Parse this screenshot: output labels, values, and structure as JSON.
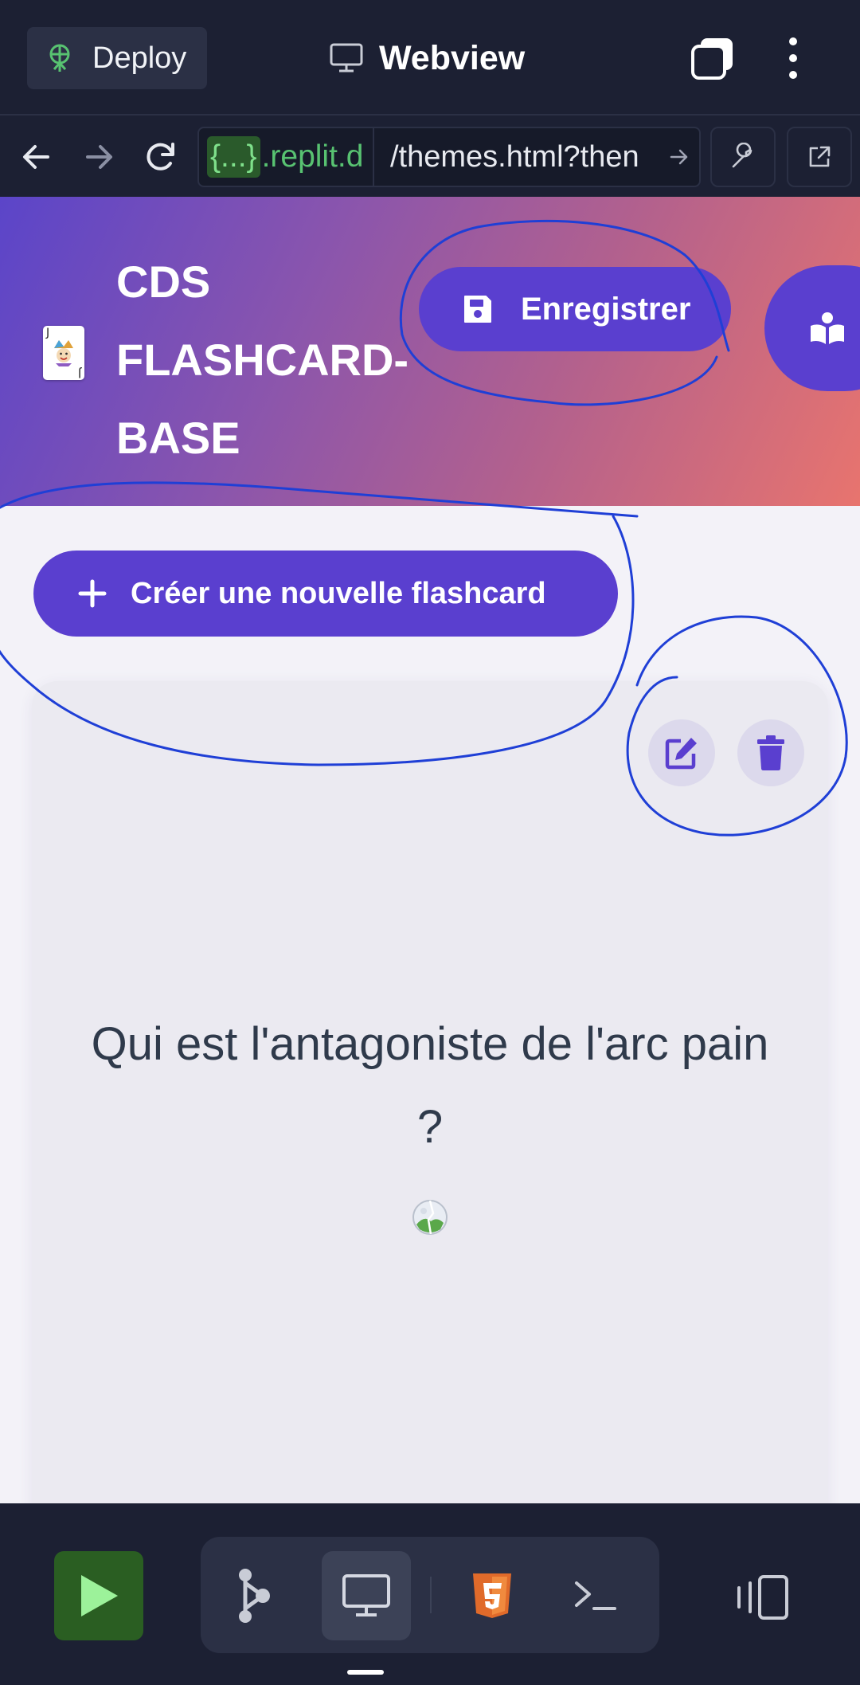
{
  "replit": {
    "deploy_label": "Deploy",
    "webview_title": "Webview",
    "url_host_braces": "{...}",
    "url_host_rest": ".replit.d",
    "url_path": "/themes.html?then"
  },
  "app": {
    "title_lines": [
      "CDS",
      "FLASHCARD-",
      "BASE"
    ],
    "save_label": "Enregistrer",
    "create_label": "Créer une nouvelle flashcard",
    "logo_corner": "J"
  },
  "card": {
    "question": "Qui est l'antagoniste de l'arc pain ?"
  },
  "colors": {
    "accent": "#5a3fcf",
    "header_gradient_start": "#5b45c9",
    "header_gradient_end": "#e8746e",
    "annotation": "#1f3fd6",
    "run_green": "#2a5e22",
    "url_green": "#58c271"
  },
  "icons": {
    "deploy": "deploy-icon",
    "monitor": "monitor-icon",
    "tabs": "tabs-icon",
    "more": "kebab-icon",
    "save": "floppy-disk-icon",
    "book": "reader-icon",
    "plus": "plus-icon",
    "edit": "edit-icon",
    "delete": "trash-icon"
  }
}
